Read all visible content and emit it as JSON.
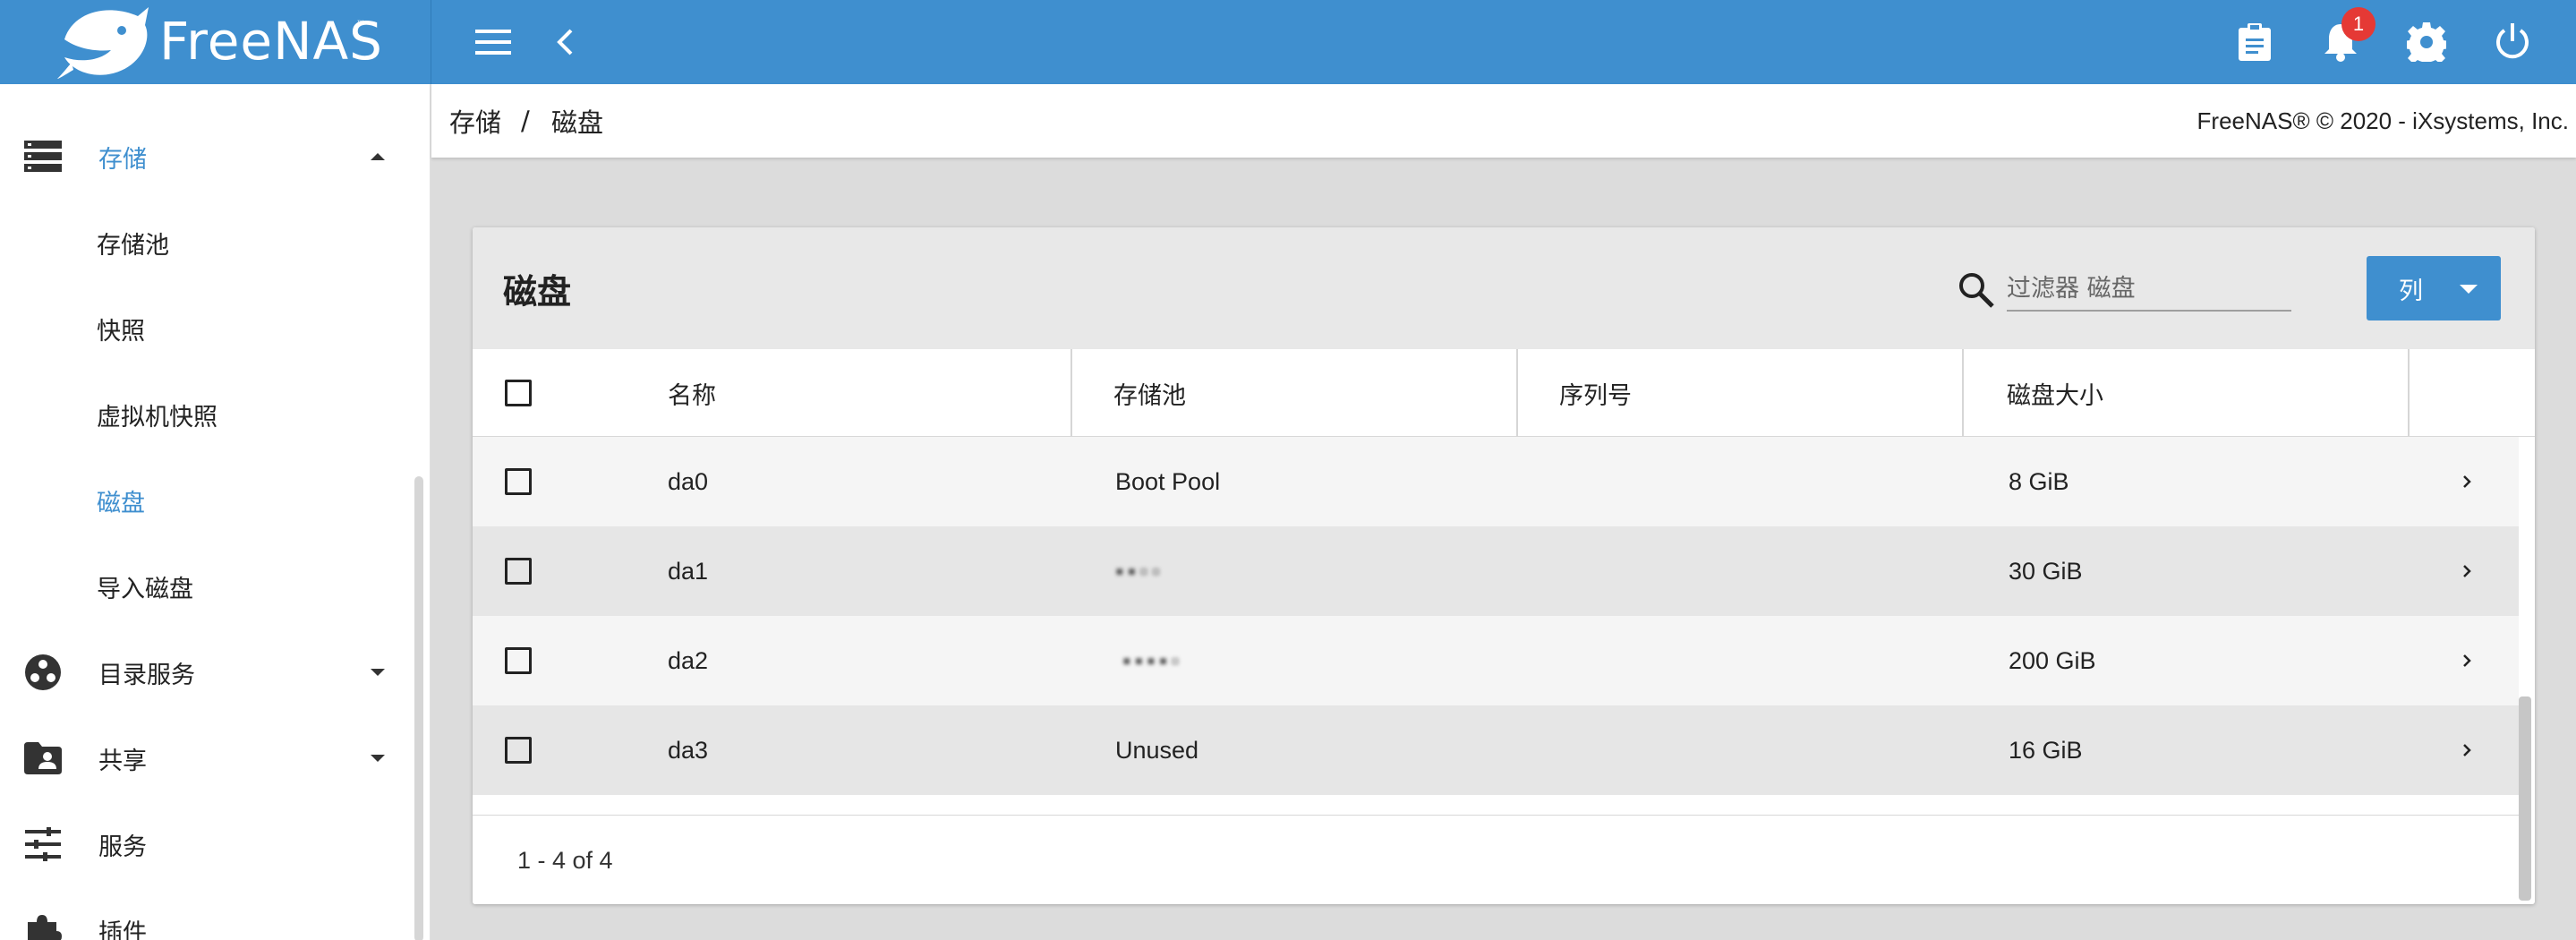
{
  "app": {
    "name": "FreeNAS",
    "trademark": "™"
  },
  "topbar": {
    "notifications_count": "1",
    "accent_color": "#3f8fcf"
  },
  "sidebar": {
    "items": [
      {
        "label": "存储",
        "icon": "storage-icon",
        "active": true,
        "expanded": true
      },
      {
        "label": "存储池",
        "sub": true
      },
      {
        "label": "快照",
        "sub": true
      },
      {
        "label": "虚拟机快照",
        "sub": true
      },
      {
        "label": "磁盘",
        "sub": true,
        "active": true
      },
      {
        "label": "导入磁盘",
        "sub": true
      },
      {
        "label": "目录服务",
        "icon": "directory-services-icon"
      },
      {
        "label": "共享",
        "icon": "share-folder-icon"
      },
      {
        "label": "服务",
        "icon": "services-tune-icon"
      },
      {
        "label": "插件",
        "icon": "plugin-puzzle-icon"
      }
    ]
  },
  "breadcrumb": {
    "parent": "存储",
    "separator": "/",
    "current": "磁盘"
  },
  "copyright": "FreeNAS® © 2020 - iXsystems, Inc.",
  "card": {
    "title": "磁盘",
    "filter_placeholder": "过滤器 磁盘",
    "columns_button": "列"
  },
  "table": {
    "headers": [
      "名称",
      "存储池",
      "序列号",
      "磁盘大小"
    ],
    "rows": [
      {
        "name": "da0",
        "pool": "Boot Pool",
        "serial": "",
        "size": "8 GiB"
      },
      {
        "name": "da1",
        "pool": "▪▪▫▫",
        "serial": "",
        "size": "30 GiB"
      },
      {
        "name": "da2",
        "pool": "▪▪▪▪▫",
        "serial": "",
        "size": "200 GiB"
      },
      {
        "name": "da3",
        "pool": "Unused",
        "serial": "",
        "size": "16 GiB"
      }
    ]
  },
  "pager": "1 - 4 of 4"
}
